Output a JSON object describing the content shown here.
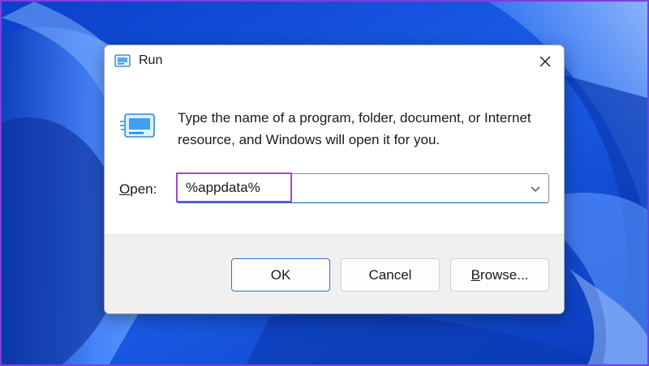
{
  "dialog": {
    "title": "Run",
    "description": "Type the name of a program, folder, document, or Internet resource, and Windows will open it for you.",
    "open_label_accel": "O",
    "open_label_rest": "pen:",
    "open_value": "%appdata%",
    "buttons": {
      "ok": "OK",
      "cancel": "Cancel",
      "browse_accel": "B",
      "browse_rest": "rowse..."
    }
  },
  "icons": {
    "title_icon": "run-icon",
    "dialog_icon": "run-icon",
    "close": "close-icon",
    "dropdown": "chevron-down-icon"
  },
  "colors": {
    "highlight": "#9b4ad6",
    "wallpaper": "#1a4fd8",
    "ok_border": "#2f6fbf"
  }
}
